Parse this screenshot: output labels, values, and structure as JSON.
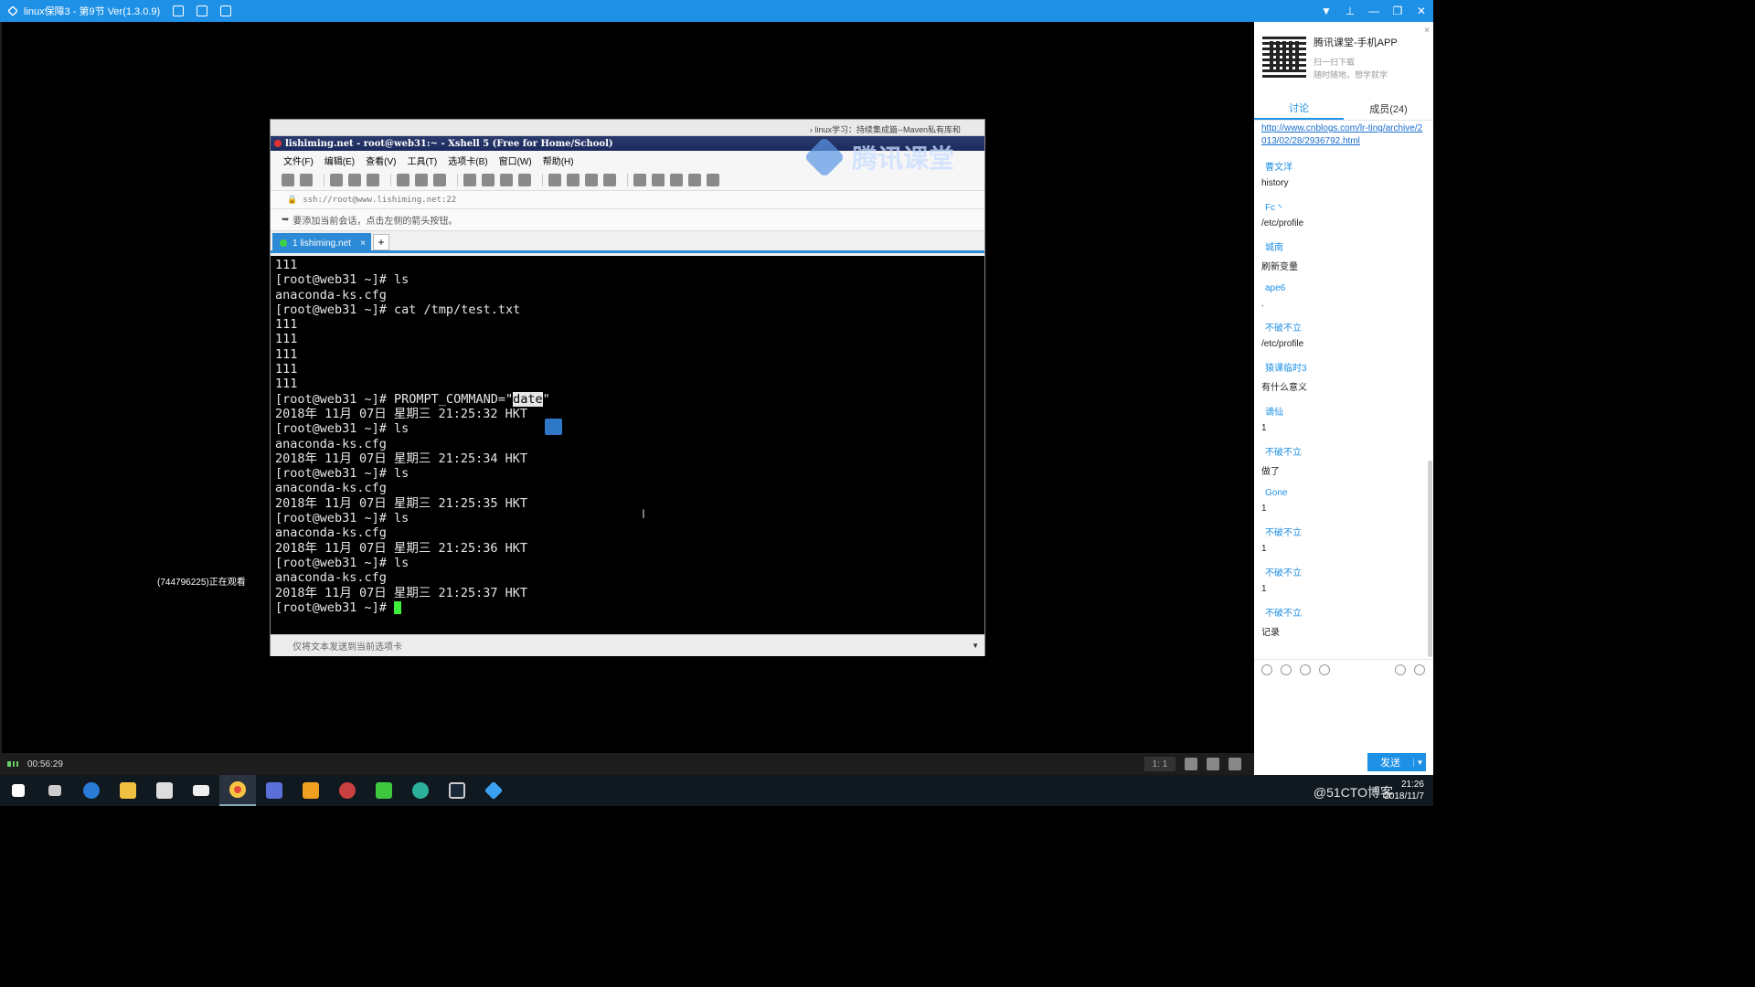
{
  "app": {
    "title": "linux保障3 - 第9节 Ver(1.3.0.9)",
    "brand_color": "#1e90e6"
  },
  "video": {
    "watching_text": "(744796225)正在观看",
    "watermark_text": "腾讯课堂"
  },
  "xshell": {
    "browser_tab_text": "› linux学习：持续集成篇--Maven私有库和",
    "title": "lishiming.net - root@web31:~ - Xshell 5 (Free for Home/School)",
    "menu": [
      "文件(F)",
      "编辑(E)",
      "查看(V)",
      "工具(T)",
      "选项卡(B)",
      "窗口(W)",
      "帮助(H)"
    ],
    "address": "ssh://root@www.lishiming.net:22",
    "hint": "要添加当前会话，点击左侧的箭头按钮。",
    "tab_label": "1 lishiming.net",
    "tab_close": "×",
    "tab_add": "+",
    "terminal_lines": [
      "111",
      "[root@web31 ~]# ls",
      "anaconda-ks.cfg",
      "[root@web31 ~]# cat /tmp/test.txt",
      "111",
      "111",
      "111",
      "111",
      "111"
    ],
    "prompt_cmd_prefix": "[root@web31 ~]# PROMPT_COMMAND=\"",
    "prompt_cmd_highlight": "date",
    "prompt_cmd_suffix": "\"",
    "terminal_lines_after": [
      "2018年 11月 07日 星期三 21:25:32 HKT",
      "[root@web31 ~]# ls",
      "anaconda-ks.cfg",
      "2018年 11月 07日 星期三 21:25:34 HKT",
      "[root@web31 ~]# ls",
      "anaconda-ks.cfg",
      "2018年 11月 07日 星期三 21:25:35 HKT",
      "[root@web31 ~]# ls",
      "anaconda-ks.cfg",
      "2018年 11月 07日 星期三 21:25:36 HKT",
      "[root@web31 ~]# ls",
      "anaconda-ks.cfg",
      "2018年 11月 07日 星期三 21:25:37 HKT"
    ],
    "final_prompt": "[root@web31 ~]# ",
    "bottom_bar_text": "仅将文本发送到当前选项卡"
  },
  "player": {
    "time": "00:56:29",
    "ratio": "1: 1"
  },
  "right_panel": {
    "app_title": "腾讯课堂-手机APP",
    "scan_line1": "扫一扫下载",
    "scan_line2": "随时随地，想学就学",
    "close": "×",
    "tabs": [
      "讨论",
      "成员(24)"
    ],
    "link": "http://www.cnblogs.com/lr-ting/archive/2013/02/28/2936792.html",
    "messages": [
      {
        "name": "曹文洋",
        "text": "history"
      },
      {
        "name": "Fc丶",
        "text": "/etc/profile"
      },
      {
        "name": "城南",
        "text": "刷新变量"
      },
      {
        "name": "ape6",
        "text": "."
      },
      {
        "name": "不破不立",
        "text": "/etc/profile"
      },
      {
        "name": "猿课临时3",
        "text": "有什么意义"
      },
      {
        "name": "谪仙",
        "text": "1"
      },
      {
        "name": "不破不立",
        "text": "做了"
      },
      {
        "name": "Gone",
        "text": "1"
      },
      {
        "name": "不破不立",
        "text": "1"
      },
      {
        "name": "不破不立",
        "text": "1"
      },
      {
        "name": "不破不立",
        "text": "记录"
      }
    ],
    "send_label": "发送",
    "send_dropdown": "▼"
  },
  "taskbar": {
    "clock_time": "21:26",
    "clock_date": "2018/11/7",
    "watermark": "@51CTO博客",
    "items": [
      "start",
      "task-view",
      "edge",
      "file-explorer",
      "store",
      "mail",
      "chrome",
      "app-1",
      "app-2",
      "app-3",
      "iqiyi",
      "app-4",
      "steam",
      "tencent-classroom"
    ]
  }
}
